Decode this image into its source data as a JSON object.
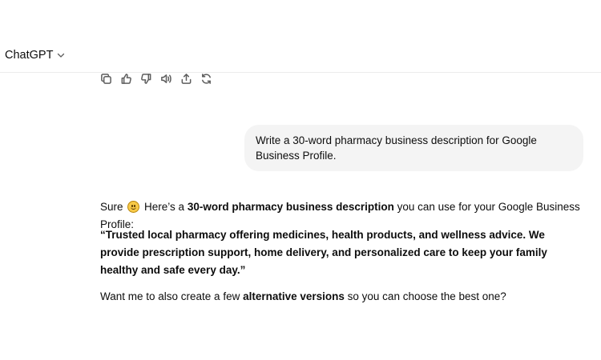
{
  "header": {
    "model_name": "ChatGPT"
  },
  "actions": {
    "icons": [
      "copy-icon",
      "thumbs-up-icon",
      "thumbs-down-icon",
      "read-aloud-icon",
      "share-icon",
      "regenerate-icon"
    ]
  },
  "user_message": {
    "text": "Write a 30-word pharmacy business description for Google Business Profile."
  },
  "assistant_message": {
    "intro_before_emoji": "Sure ",
    "intro_after_emoji": " Here’s a ",
    "intro_bold": "30-word pharmacy business description",
    "intro_end": " you can use for your Google Business Profile:",
    "quote": "“Trusted local pharmacy offering medicines, health products, and wellness advice. We provide prescription support, home delivery, and personalized care to keep your family healthy and safe every day.”",
    "followup_start": "Want me to also create a few ",
    "followup_bold": "alternative versions",
    "followup_end": " so you can choose the best one?"
  }
}
